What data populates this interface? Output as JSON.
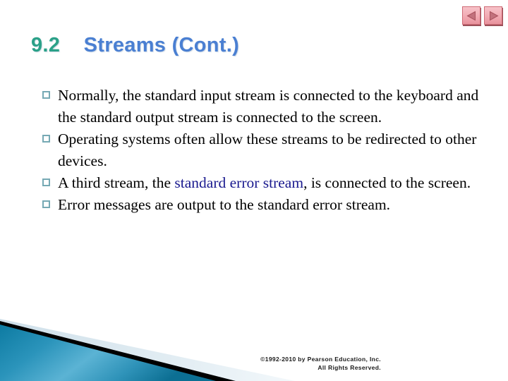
{
  "slide": {
    "title": {
      "number": "9.2",
      "text": "Streams (Cont.)",
      "number_color": "#2ba188",
      "text_color": "#4a7fd2"
    },
    "bullets": [
      {
        "id": "bullet-normally",
        "segments": [
          {
            "text": "Normally, the standard input stream is connected to the keyboard and the standard output stream is connected to the screen.",
            "style": "normal"
          }
        ]
      },
      {
        "id": "bullet-operating-systems",
        "segments": [
          {
            "text": "Operating systems often allow these streams to be redirected to other devices.",
            "style": "normal"
          }
        ]
      },
      {
        "id": "bullet-third-stream",
        "segments": [
          {
            "text": "A third stream, the ",
            "style": "normal"
          },
          {
            "text": "standard error stream",
            "style": "highlight-blue"
          },
          {
            "text": ", is connected to the screen.",
            "style": "normal"
          }
        ]
      },
      {
        "id": "bullet-error-messages",
        "segments": [
          {
            "text": "Error messages are output to the standard error stream.",
            "style": "normal"
          }
        ]
      }
    ],
    "nav": {
      "previous_label": "previous-slide",
      "next_label": "next-slide",
      "button_face_color": "#f2aab3",
      "button_border_color": "#cf6b76",
      "arrow_color": "#c2717c"
    },
    "footer": {
      "line1": "©1992-2010 by Pearson Education, Inc.",
      "line2": "All Rights Reserved."
    },
    "decoration": {
      "teal_dark": "#0d7ba2",
      "teal_light": "#5bb3d4",
      "black_band": "#000000",
      "pale_band": "#dbe8ef"
    }
  }
}
